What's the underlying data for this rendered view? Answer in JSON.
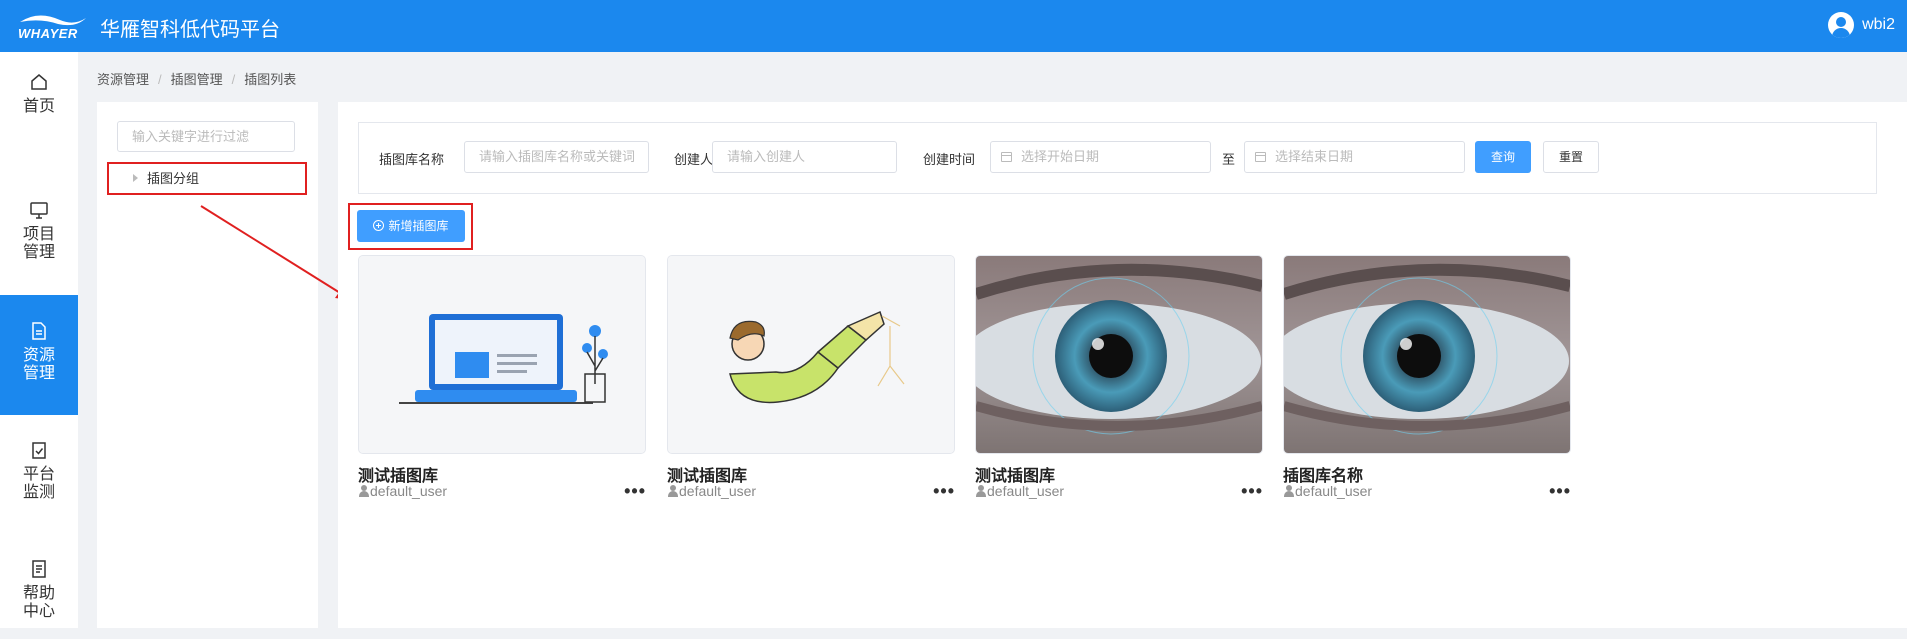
{
  "header": {
    "logo_text": "WHAYER",
    "title": "华雁智科低代码平台",
    "username": "wbi2"
  },
  "sidebar": {
    "items": [
      {
        "label": "首页"
      },
      {
        "label": "项目管理"
      },
      {
        "label": "资源管理"
      },
      {
        "label": "平台监测"
      },
      {
        "label": "帮助中心"
      }
    ]
  },
  "breadcrumb": [
    "资源管理",
    "插图管理",
    "插图列表"
  ],
  "tree": {
    "filter_placeholder": "输入关键字进行过滤",
    "node_label": "插图分组"
  },
  "search": {
    "name_label": "插图库名称",
    "name_placeholder": "请输入插图库名称或关键词",
    "creator_label": "创建人",
    "creator_placeholder": "请输入创建人",
    "time_label": "创建时间",
    "start_placeholder": "选择开始日期",
    "to_label": "至",
    "end_placeholder": "选择结束日期",
    "query_label": "查询",
    "reset_label": "重置"
  },
  "add_button_label": "新增插图库",
  "cards": [
    {
      "title": "测试插图库",
      "user": "default_user",
      "image": "laptop-illustration"
    },
    {
      "title": "测试插图库",
      "user": "default_user",
      "image": "telescope-boy-illustration"
    },
    {
      "title": "测试插图库",
      "user": "default_user",
      "image": "eye-photo"
    },
    {
      "title": "插图库名称",
      "user": "default_user",
      "image": "eye-photo"
    }
  ],
  "colors": {
    "primary": "#1b88ee",
    "button": "#409eff",
    "highlight": "#e02020"
  }
}
